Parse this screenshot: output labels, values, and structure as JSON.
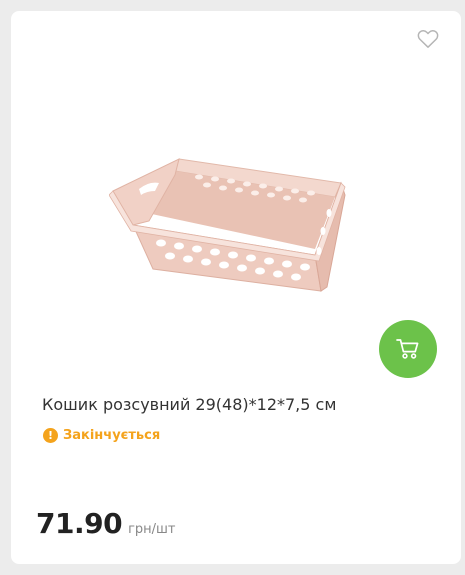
{
  "product": {
    "title": "Кошик розсувний 29(48)*12*7,5 см",
    "status": "Закінчується",
    "price": "71.90",
    "unit": "грн/шт",
    "image": "pink-plastic-basket"
  },
  "icons": {
    "favorite": "heart-outline-icon",
    "cart": "shopping-cart-icon",
    "status": "exclamation-circle-icon"
  },
  "colors": {
    "accent": "#6cc24a",
    "warning": "#f4a31c",
    "basket": "#eecbbf"
  }
}
